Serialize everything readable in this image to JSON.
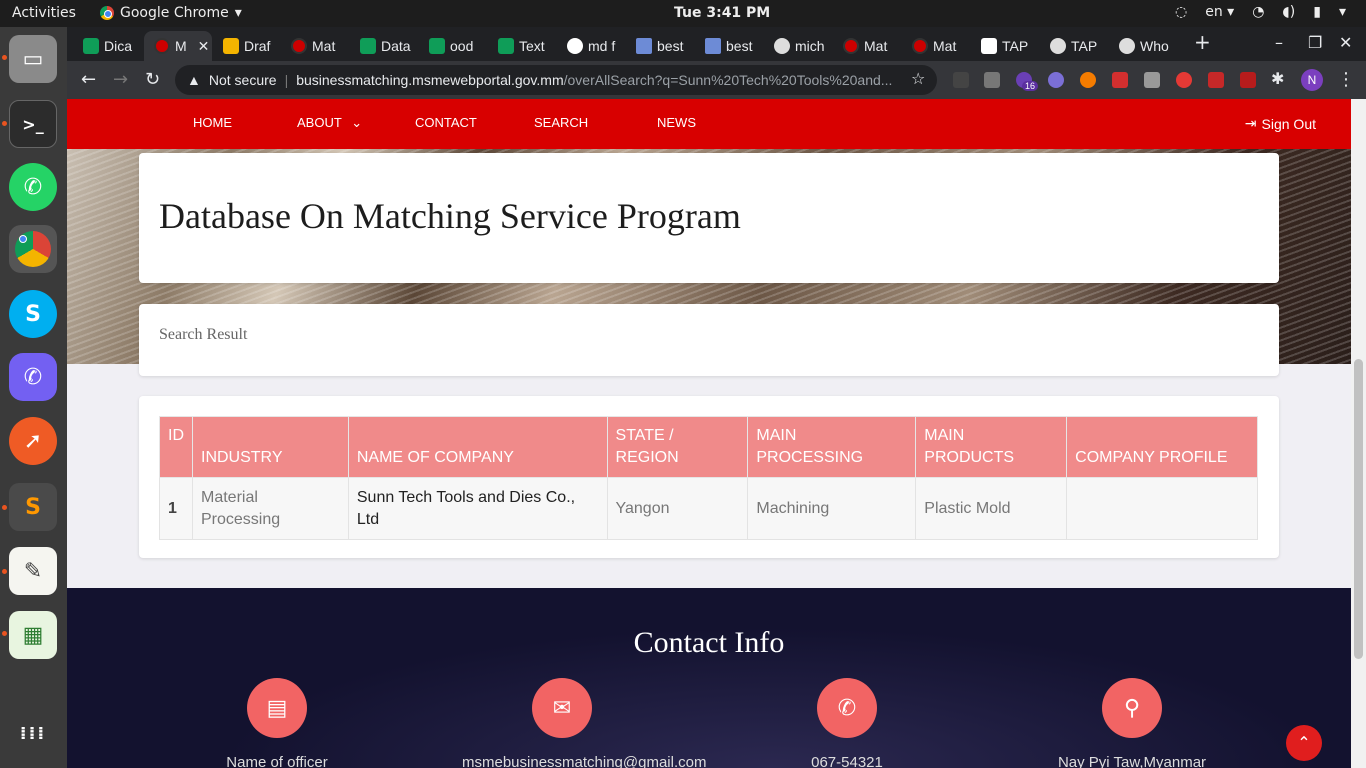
{
  "system": {
    "activities": "Activities",
    "app_name": "Google Chrome",
    "clock": "Tue  3:41 PM",
    "language": "en"
  },
  "tabs": [
    {
      "label": "Dica",
      "icon": "sheets-icon"
    },
    {
      "label": "M",
      "icon": "site-icon",
      "active": true
    },
    {
      "label": "Draf",
      "icon": "slides-icon"
    },
    {
      "label": "Mat",
      "icon": "site-icon"
    },
    {
      "label": "Data",
      "icon": "sheets-icon"
    },
    {
      "label": "ood",
      "icon": "sheets-icon"
    },
    {
      "label": "Text",
      "icon": "sheets-icon"
    },
    {
      "label": "md f",
      "icon": "google-icon"
    },
    {
      "label": "best",
      "icon": "arrow-icon"
    },
    {
      "label": "best",
      "icon": "arrow-icon"
    },
    {
      "label": "mich",
      "icon": "shield-icon"
    },
    {
      "label": "Mat",
      "icon": "site-icon"
    },
    {
      "label": "Mat",
      "icon": "site-icon"
    },
    {
      "label": "TAP",
      "icon": "top-icon"
    },
    {
      "label": "TAP",
      "icon": "globe-icon"
    },
    {
      "label": "Who",
      "icon": "globe-icon"
    }
  ],
  "omnibox": {
    "security": "Not secure",
    "host": "businessmatching.msmewebportal.gov.mm",
    "path": "/overAllSearch?q=Sunn%20Tech%20Tools%20and..."
  },
  "extensions": {
    "badge": "16",
    "profile_initial": "N"
  },
  "nav": {
    "items": [
      "HOME",
      "ABOUT",
      "CONTACT",
      "SEARCH",
      "NEWS"
    ],
    "signout": "Sign Out"
  },
  "page": {
    "title": "Database On Matching Service Program",
    "result_heading": "Search Result"
  },
  "table": {
    "headers": [
      "ID",
      "INDUSTRY",
      "NAME OF COMPANY",
      "STATE / REGION",
      "MAIN PROCESSING",
      "MAIN PRODUCTS",
      "COMPANY PROFILE"
    ],
    "rows": [
      [
        "1",
        "Material Processing",
        "Sunn Tech Tools and Dies Co., Ltd",
        "Yangon",
        "Machining",
        "Plastic Mold",
        ""
      ]
    ]
  },
  "footer": {
    "title": "Contact Info",
    "items": [
      {
        "icon": "id-card-icon",
        "text": "Name of officer"
      },
      {
        "icon": "envelope-icon",
        "text": "msmebusinessmatching@gmail.com"
      },
      {
        "icon": "phone-icon",
        "text": "067-54321"
      },
      {
        "icon": "location-pin-icon",
        "text": "Nay Pyi Taw,Myanmar"
      }
    ]
  },
  "colors": {
    "navbar": "#d80000",
    "table_header": "#f08a8a",
    "contact_circle": "#f26464",
    "footer_bg": "#13122f"
  }
}
